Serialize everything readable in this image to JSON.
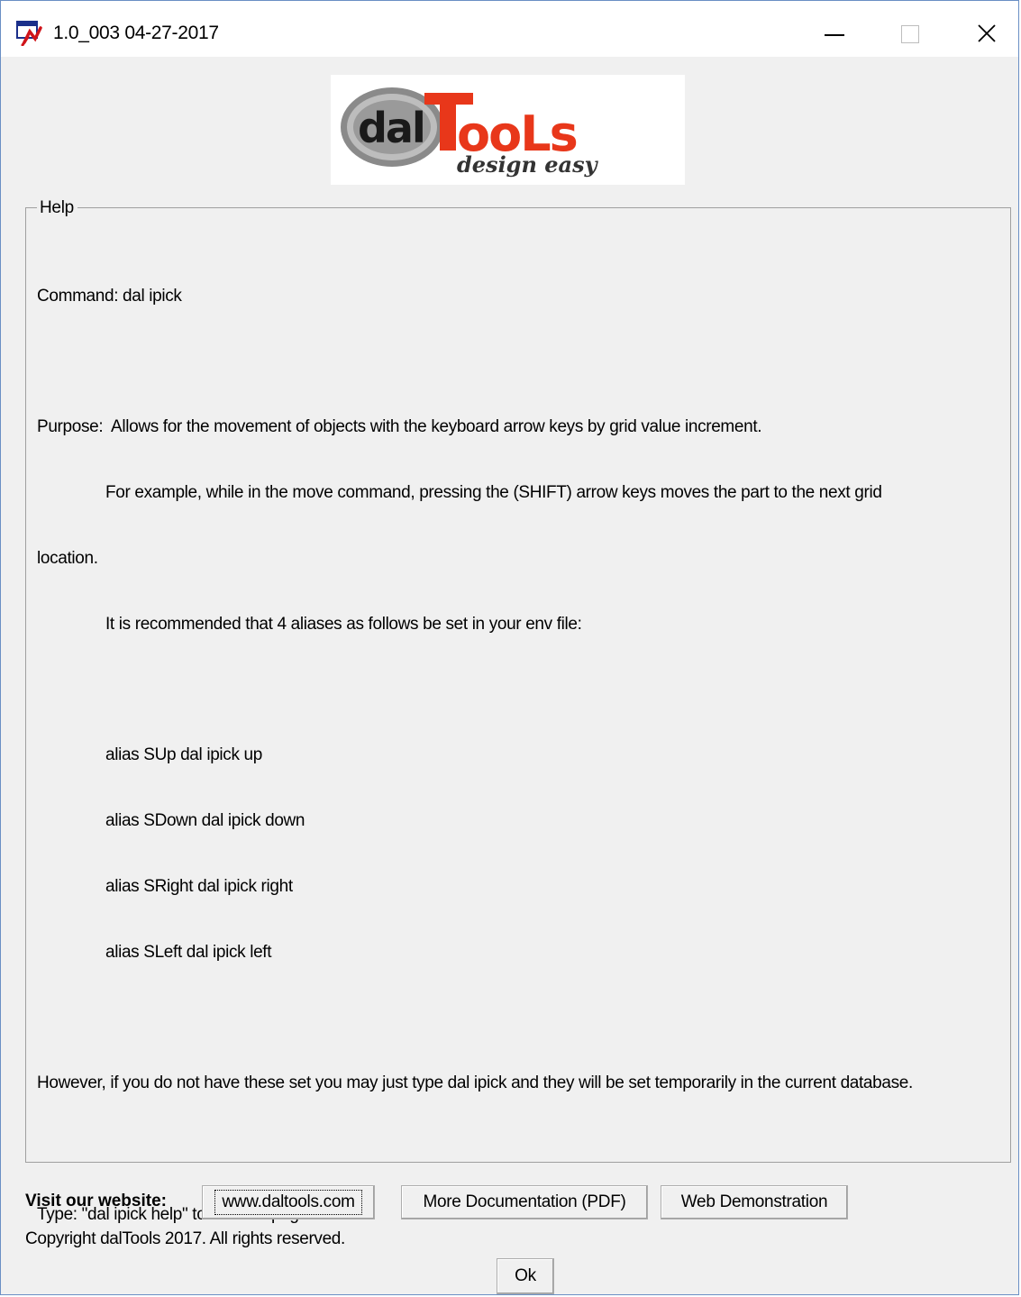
{
  "window": {
    "title": "1.0_003 04-27-2017",
    "icon": "app-icon"
  },
  "logo": {
    "brand_left": "dal",
    "brand_right": "TooLs",
    "tagline": "design easy"
  },
  "help": {
    "group_label": "Help",
    "command": "Command: dal ipick",
    "purpose": "Purpose:  Allows for the movement of objects with the keyboard arrow keys by grid value increment.",
    "example_line1": "For example, while in the move command, pressing the (SHIFT) arrow keys moves the part to the next grid",
    "example_line2": "location.",
    "recommend": "It is recommended that 4 aliases as follows be set in your env file:",
    "aliases": [
      "alias SUp dal ipick up",
      "alias SDown dal ipick down",
      "alias SRight dal ipick right",
      "alias SLeft dal ipick left"
    ],
    "however": "However, if you do not have these set you may just type dal ipick and they will be set temporarily in the current database.",
    "type_hint": "Type: \"dal ipick help\" to see this page."
  },
  "footer": {
    "visit_label": "Visit our website:",
    "website_button": "www.daltools.com",
    "docs_button": "More Documentation (PDF)",
    "demo_button": "Web Demonstration",
    "copyright": "Copyright dalTools 2017. All rights reserved.",
    "ok_button": "Ok"
  }
}
